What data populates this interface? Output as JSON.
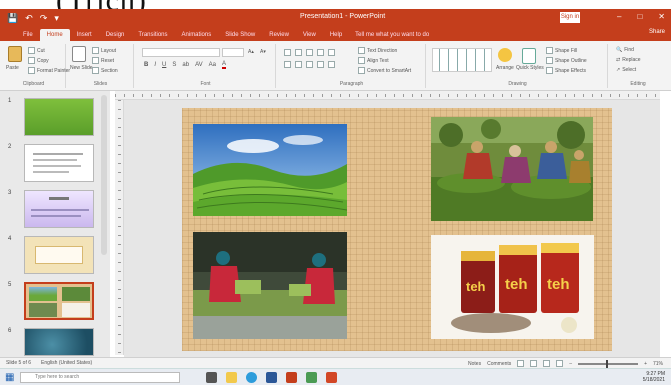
{
  "caption": "(Trích)",
  "window": {
    "title": "Presentation1 - PowerPoint",
    "signin": "Sign in",
    "share": "Share",
    "controls": [
      "–",
      "□",
      "✕"
    ]
  },
  "quick_access": [
    "save-icon",
    "undo-icon",
    "redo-icon",
    "start-icon"
  ],
  "tabs": [
    "File",
    "Home",
    "Insert",
    "Design",
    "Transitions",
    "Animations",
    "Slide Show",
    "Review",
    "View",
    "Help"
  ],
  "active_tab": "Home",
  "tell_me": "Tell me what you want to do",
  "ribbon": {
    "clipboard": {
      "label": "Clipboard",
      "paste": "Paste",
      "cut": "Cut",
      "copy": "Copy",
      "format_painter": "Format Painter"
    },
    "slides": {
      "label": "Slides",
      "new_slide": "New Slide",
      "layout": "Layout",
      "reset": "Reset",
      "section": "Section"
    },
    "font": {
      "label": "Font",
      "buttons": [
        "B",
        "I",
        "U",
        "S",
        "ab",
        "AV",
        "Aa",
        "A"
      ]
    },
    "paragraph": {
      "label": "Paragraph",
      "text_direction": "Text Direction",
      "align_text": "Align Text",
      "smartart": "Convert to SmartArt"
    },
    "drawing": {
      "label": "Drawing",
      "arrange": "Arrange",
      "quick_styles": "Quick Styles",
      "shape_fill": "Shape Fill",
      "shape_outline": "Shape Outline",
      "shape_effects": "Shape Effects"
    },
    "editing": {
      "label": "Editing",
      "find": "Find",
      "replace": "Replace",
      "select": "Select"
    }
  },
  "thumbnails": [
    {
      "num": "1"
    },
    {
      "num": "2"
    },
    {
      "num": "3"
    },
    {
      "num": "4"
    },
    {
      "num": "5"
    },
    {
      "num": "6"
    }
  ],
  "slide_photos": [
    {
      "name": "tea-hills-photo"
    },
    {
      "name": "tea-pickers-photo"
    },
    {
      "name": "tea-processing-photo"
    },
    {
      "name": "teh-packages-photo"
    }
  ],
  "teh_label": "teh",
  "statusbar": {
    "slide_info": "Slide 5 of 6",
    "language": "English (United States)",
    "notes": "Notes",
    "comments": "Comments",
    "zoom": "71%"
  },
  "taskbar": {
    "search_placeholder": "Type here to search",
    "time": "9:27 PM",
    "date": "5/18/2021"
  },
  "colors": {
    "accent": "#c43e1c",
    "slide_background": "#e3c18f"
  }
}
